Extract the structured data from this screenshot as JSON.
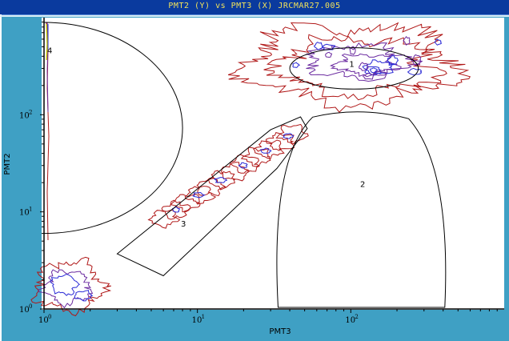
{
  "window": {
    "title": "PMT2 (Y) vs PMT3 (X) JRCMAR27.005"
  },
  "chart_data": {
    "type": "contour",
    "xlabel": "PMT3",
    "ylabel": "PMT2",
    "xscale": "log",
    "yscale": "log",
    "xlim": [
      1,
      1000
    ],
    "ylim": [
      1,
      1000
    ],
    "xticks": [
      {
        "base": "10",
        "exp": "0",
        "value": 1
      },
      {
        "base": "10",
        "exp": "1",
        "value": 10
      },
      {
        "base": "10",
        "exp": "2",
        "value": 100
      }
    ],
    "yticks": [
      {
        "base": "10",
        "exp": "0",
        "value": 1
      },
      {
        "base": "10",
        "exp": "1",
        "value": 10
      },
      {
        "base": "10",
        "exp": "2",
        "value": 100
      }
    ],
    "gates": [
      {
        "label": "1",
        "shape": "ellipse",
        "center": [
          105,
          300
        ],
        "x_radius": [
          45,
          310
        ],
        "y_radius": [
          195,
          520
        ]
      },
      {
        "label": "2",
        "shape": "arch",
        "x_range": [
          32,
          420
        ],
        "y_range": [
          1,
          110
        ],
        "label_at": [
          115,
          18
        ]
      },
      {
        "label": "3",
        "shape": "polygon",
        "points": [
          [
            3,
            3.7
          ],
          [
            6,
            2.2
          ],
          [
            33,
            28
          ],
          [
            52,
            72
          ],
          [
            47,
            95
          ],
          [
            30,
            70
          ]
        ]
      },
      {
        "label": "4",
        "shape": "half-ellipse",
        "x_range": [
          1,
          8
        ],
        "y_range": [
          6,
          1000
        ],
        "label_at": [
          1.05,
          430
        ]
      }
    ],
    "populations": [
      {
        "name": "",
        "center": [
          100,
          330
        ],
        "spread": "x 40–300, y 170–600",
        "levels": [
          "red",
          "purple",
          "blue"
        ]
      },
      {
        "name": "",
        "center": [
          14,
          16
        ],
        "spread": "diagonal band x 6–50, y 4–90",
        "levels": [
          "red",
          "blue"
        ]
      },
      {
        "name": "",
        "center": [
          1.5,
          1.6
        ],
        "spread": "x 1–3, y 1–2.8",
        "levels": [
          "red",
          "purple",
          "blue"
        ]
      },
      {
        "name": "",
        "center": [
          1.1,
          80
        ],
        "spread": "x 1–1.2, y 10–900",
        "levels": [
          "red",
          "purple",
          "blue",
          "yellow"
        ]
      }
    ],
    "colors": {
      "outer": "#b01818",
      "mid": "#6b2ba0",
      "inner": "#2a2ad6",
      "core": "#c8c800",
      "gate": "#000000",
      "frame": "#3fa0c4"
    },
    "grid": false
  }
}
